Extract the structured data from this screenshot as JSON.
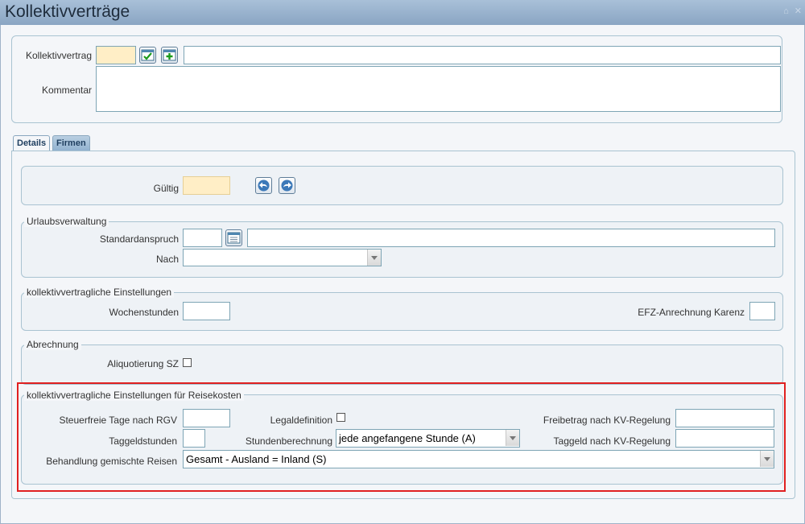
{
  "window": {
    "title": "Kollektivverträge",
    "controls": "⌂ ✕"
  },
  "header_form": {
    "kollektivvertrag_label": "Kollektivvertrag",
    "kollektivvertrag_code": "",
    "kollektivvertrag_name": "",
    "kommentar_label": "Kommentar",
    "kommentar_value": ""
  },
  "tabs": [
    {
      "label": "Details",
      "active": true
    },
    {
      "label": "Firmen",
      "active": false
    }
  ],
  "gueltig": {
    "label": "Gültig",
    "value": ""
  },
  "urlaub": {
    "legend": "Urlaubsverwaltung",
    "standardanspruch_label": "Standardanspruch",
    "standardanspruch_value": "",
    "standardanspruch_text": "",
    "nach_label": "Nach",
    "nach_value": ""
  },
  "kv_einstellungen": {
    "legend": "kollektivvertragliche Einstellungen",
    "wochenstunden_label": "Wochenstunden",
    "wochenstunden_value": "",
    "efz_label": "EFZ-Anrechnung Karenz",
    "efz_value": ""
  },
  "abrechnung": {
    "legend": "Abrechnung",
    "aliquotierung_label": "Aliquotierung SZ",
    "aliquotierung_checked": false
  },
  "reisekosten": {
    "legend": "kollektivvertragliche Einstellungen für Reisekosten",
    "steuerfreie_label": "Steuerfreie Tage nach RGV",
    "steuerfreie_value": "",
    "taggeldstunden_label": "Taggeldstunden",
    "taggeldstunden_value": "",
    "legaldefinition_label": "Legaldefinition",
    "legaldefinition_checked": false,
    "stundenberechnung_label": "Stundenberechnung",
    "stundenberechnung_value": "jede angefangene Stunde (A)",
    "freibetrag_label": "Freibetrag nach KV-Regelung",
    "freibetrag_value": "",
    "taggeld_label": "Taggeld nach KV-Regelung",
    "taggeld_value": "",
    "behandlung_label": "Behandlung gemischte Reisen",
    "behandlung_value": "Gesamt - Ausland = Inland (S)"
  },
  "colors": {
    "title_bar": "#9bb3ce",
    "highlight_border": "#e02020",
    "input_yellow": "#ffeec6"
  }
}
